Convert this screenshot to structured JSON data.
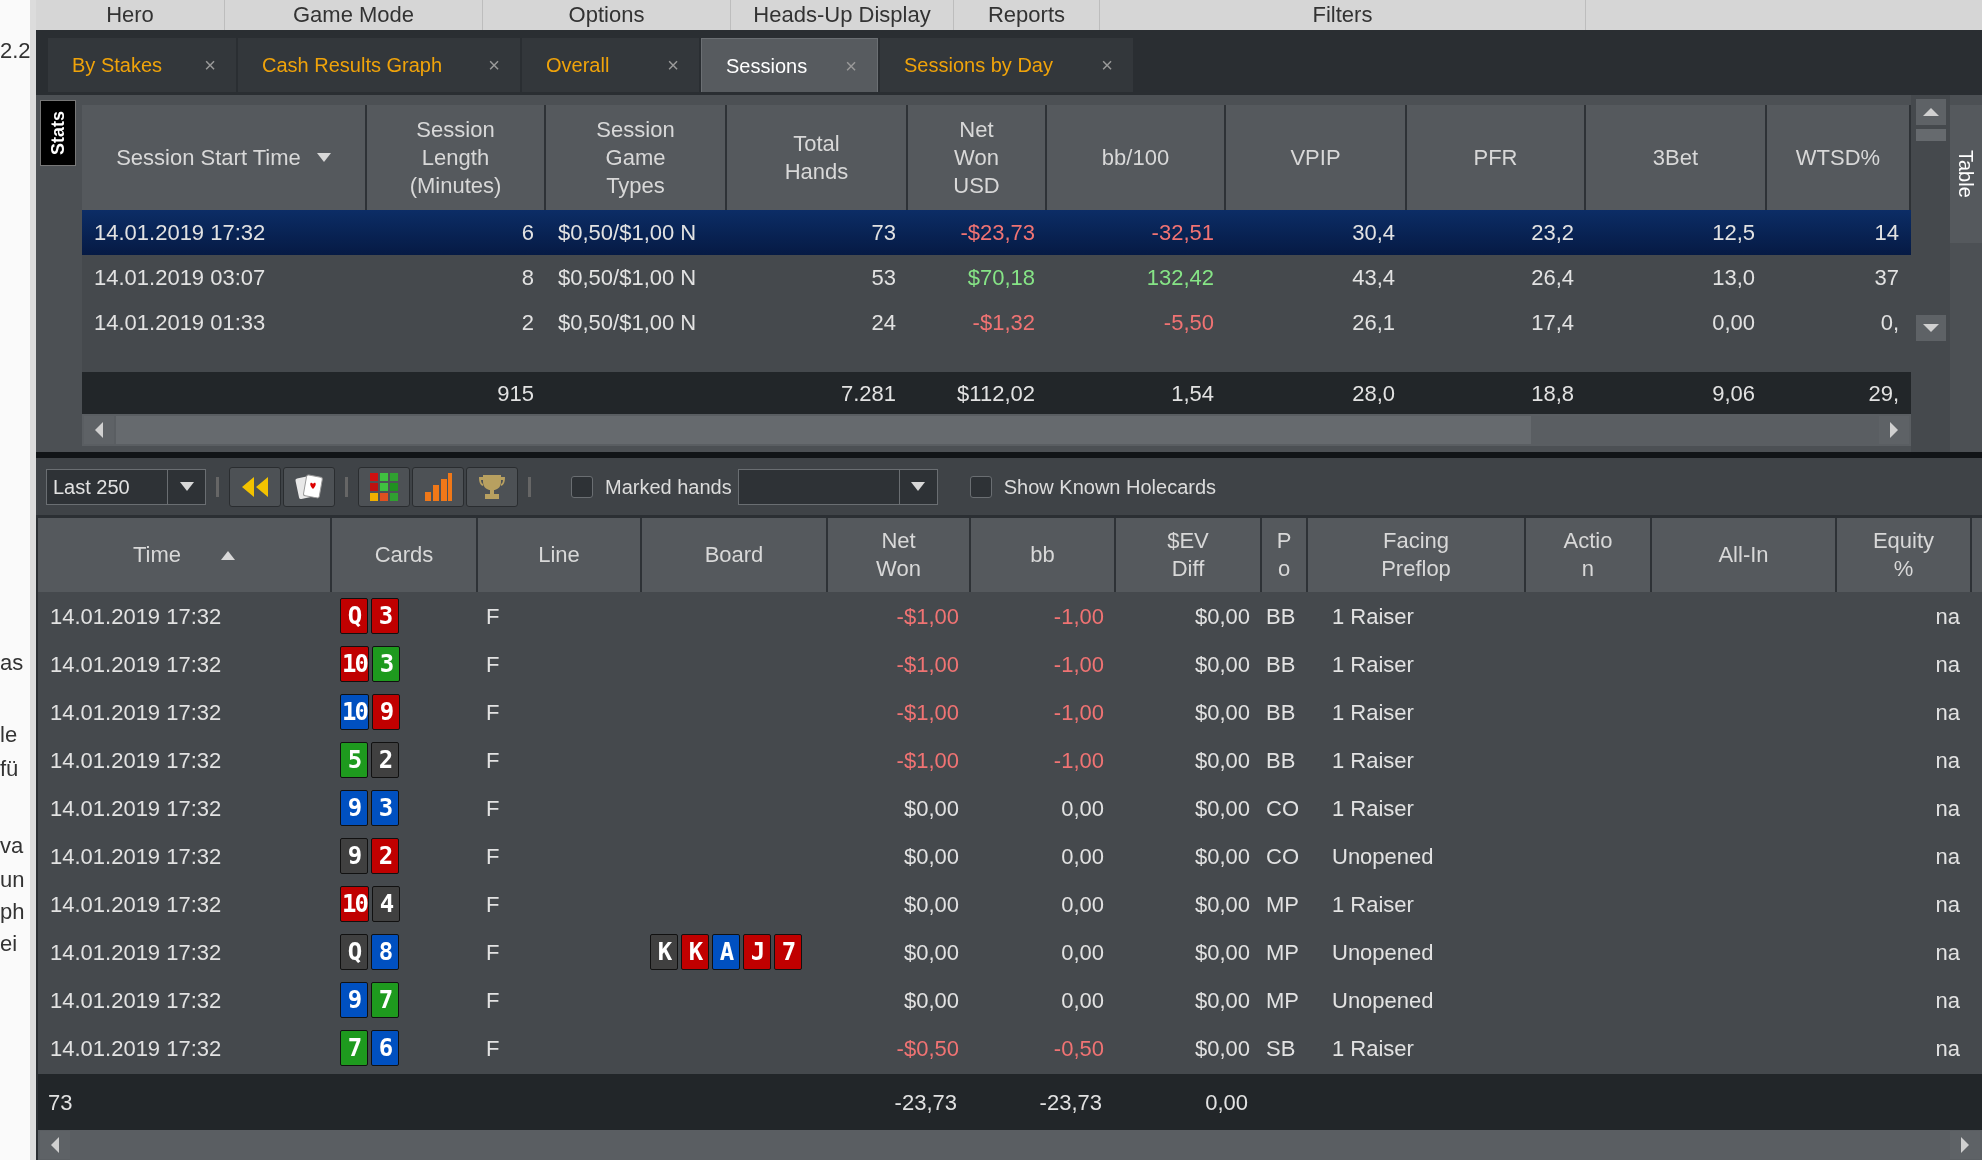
{
  "left_edge": [
    "2.2",
    "as",
    "le",
    "fü",
    "va",
    "un",
    "ph",
    "ei"
  ],
  "menu": [
    {
      "label": "Hero"
    },
    {
      "label": "Game Mode"
    },
    {
      "label": "Options"
    },
    {
      "label": "Heads-Up Display"
    },
    {
      "label": "Reports"
    },
    {
      "label": "Filters"
    }
  ],
  "tabs": [
    {
      "label": "By Stakes",
      "close": "×",
      "selected": false
    },
    {
      "label": "Cash Results Graph",
      "close": "×",
      "selected": false
    },
    {
      "label": "Overall",
      "close": "×",
      "selected": false
    },
    {
      "label": "Sessions",
      "close": "×",
      "selected": true
    },
    {
      "label": "Sessions by Day",
      "close": "×",
      "selected": false
    }
  ],
  "sessions": {
    "side_tab": "Stats",
    "right_tab": "Table",
    "columns": [
      {
        "lines": [
          "Session Start Time"
        ],
        "kind": "text",
        "sorted_descending": true
      },
      {
        "lines": [
          "Session",
          "Length",
          "(Minutes)"
        ],
        "kind": "number"
      },
      {
        "lines": [
          "Session",
          "Game",
          "Types"
        ],
        "kind": "text"
      },
      {
        "lines": [
          "Total",
          "Hands"
        ],
        "kind": "number"
      },
      {
        "lines": [
          "Net",
          "Won",
          "USD"
        ],
        "kind": "result"
      },
      {
        "lines": [
          "bb/100"
        ],
        "kind": "result"
      },
      {
        "lines": [
          "VPIP"
        ],
        "kind": "number"
      },
      {
        "lines": [
          "PFR"
        ],
        "kind": "number"
      },
      {
        "lines": [
          "3Bet"
        ],
        "kind": "number"
      },
      {
        "lines": [
          "WTSD%"
        ],
        "kind": "number"
      }
    ],
    "rows": [
      {
        "selected": true,
        "profit": false,
        "cells": [
          "14.01.2019 17:32",
          "6",
          "$0,50/$1,00 N",
          "73",
          "-$23,73",
          "-32,51",
          "30,4",
          "23,2",
          "12,5",
          "14"
        ]
      },
      {
        "selected": false,
        "profit": true,
        "cells": [
          "14.01.2019 03:07",
          "8",
          "$0,50/$1,00 N",
          "53",
          "$70,18",
          "132,42",
          "43,4",
          "26,4",
          "13,0",
          "37"
        ]
      },
      {
        "selected": false,
        "profit": false,
        "cells": [
          "14.01.2019 01:33",
          "2",
          "$0,50/$1,00 N",
          "24",
          "-$1,32",
          "-5,50",
          "26,1",
          "17,4",
          "0,00",
          "0,"
        ]
      }
    ],
    "totals": {
      "session_length": "915",
      "total_hands": "7.281",
      "net_won": "$112,02",
      "bb_100": "1,54",
      "vpip": "28,0",
      "pfr": "18,8",
      "three_bet": "9,06",
      "wtsd": "29,"
    }
  },
  "toolbar": {
    "range": "Last 250",
    "marked_hands": {
      "label": "Marked hands",
      "checked": false
    },
    "holecards": {
      "label": "Show Known Holecards",
      "checked": false
    }
  },
  "hands": {
    "columns": [
      {
        "lines": [
          "Time"
        ],
        "sorted_ascending": true
      },
      {
        "lines": [
          "Cards"
        ]
      },
      {
        "lines": [
          "Line"
        ]
      },
      {
        "lines": [
          "Board"
        ]
      },
      {
        "lines": [
          "Net",
          "Won"
        ]
      },
      {
        "lines": [
          "bb"
        ]
      },
      {
        "lines": [
          "$EV",
          "Diff"
        ]
      },
      {
        "lines": [
          "P",
          "o"
        ]
      },
      {
        "lines": [
          "Facing",
          "Preflop"
        ]
      },
      {
        "lines": [
          "Actio",
          "n"
        ]
      },
      {
        "lines": [
          "All-In"
        ]
      },
      {
        "lines": [
          "Equity",
          "%"
        ]
      }
    ],
    "rows": [
      {
        "time": "14.01.2019 17:32",
        "cards": [
          {
            "rank": "Q",
            "color": "#c00000"
          },
          {
            "rank": "3",
            "color": "#c00000"
          }
        ],
        "line": "F",
        "board": [],
        "net_won": "-$1,00",
        "bb": "-1,00",
        "loss": true,
        "ev_diff": "$0,00",
        "position": "BB",
        "facing": "1 Raiser",
        "equity": "na"
      },
      {
        "time": "14.01.2019 17:32",
        "cards": [
          {
            "rank": "10",
            "color": "#c00000"
          },
          {
            "rank": "3",
            "color": "#1e9a1e"
          }
        ],
        "line": "F",
        "board": [],
        "net_won": "-$1,00",
        "bb": "-1,00",
        "loss": true,
        "ev_diff": "$0,00",
        "position": "BB",
        "facing": "1 Raiser",
        "equity": "na"
      },
      {
        "time": "14.01.2019 17:32",
        "cards": [
          {
            "rank": "10",
            "color": "#0050c0"
          },
          {
            "rank": "9",
            "color": "#c00000"
          }
        ],
        "line": "F",
        "board": [],
        "net_won": "-$1,00",
        "bb": "-1,00",
        "loss": true,
        "ev_diff": "$0,00",
        "position": "BB",
        "facing": "1 Raiser",
        "equity": "na"
      },
      {
        "time": "14.01.2019 17:32",
        "cards": [
          {
            "rank": "5",
            "color": "#1e9a1e"
          },
          {
            "rank": "2",
            "color": "#404040"
          }
        ],
        "line": "F",
        "board": [],
        "net_won": "-$1,00",
        "bb": "-1,00",
        "loss": true,
        "ev_diff": "$0,00",
        "position": "BB",
        "facing": "1 Raiser",
        "equity": "na"
      },
      {
        "time": "14.01.2019 17:32",
        "cards": [
          {
            "rank": "9",
            "color": "#0050c0"
          },
          {
            "rank": "3",
            "color": "#0050c0"
          }
        ],
        "line": "F",
        "board": [],
        "net_won": "$0,00",
        "bb": "0,00",
        "loss": false,
        "ev_diff": "$0,00",
        "position": "CO",
        "facing": "1 Raiser",
        "equity": "na"
      },
      {
        "time": "14.01.2019 17:32",
        "cards": [
          {
            "rank": "9",
            "color": "#404040"
          },
          {
            "rank": "2",
            "color": "#c00000"
          }
        ],
        "line": "F",
        "board": [],
        "net_won": "$0,00",
        "bb": "0,00",
        "loss": false,
        "ev_diff": "$0,00",
        "position": "CO",
        "facing": "Unopened",
        "equity": "na"
      },
      {
        "time": "14.01.2019 17:32",
        "cards": [
          {
            "rank": "10",
            "color": "#c00000"
          },
          {
            "rank": "4",
            "color": "#404040"
          }
        ],
        "line": "F",
        "board": [],
        "net_won": "$0,00",
        "bb": "0,00",
        "loss": false,
        "ev_diff": "$0,00",
        "position": "MP",
        "facing": "1 Raiser",
        "equity": "na"
      },
      {
        "time": "14.01.2019 17:32",
        "cards": [
          {
            "rank": "Q",
            "color": "#404040"
          },
          {
            "rank": "8",
            "color": "#0050c0"
          }
        ],
        "line": "F",
        "board": [
          {
            "rank": "K",
            "color": "#404040"
          },
          {
            "rank": "K",
            "color": "#c00000"
          },
          {
            "rank": "A",
            "color": "#0050c0"
          },
          {
            "rank": "J",
            "color": "#c00000"
          },
          {
            "rank": "7",
            "color": "#c00000"
          }
        ],
        "net_won": "$0,00",
        "bb": "0,00",
        "loss": false,
        "ev_diff": "$0,00",
        "position": "MP",
        "facing": "Unopened",
        "equity": "na"
      },
      {
        "time": "14.01.2019 17:32",
        "cards": [
          {
            "rank": "9",
            "color": "#0050c0"
          },
          {
            "rank": "7",
            "color": "#1e9a1e"
          }
        ],
        "line": "F",
        "board": [],
        "net_won": "$0,00",
        "bb": "0,00",
        "loss": false,
        "ev_diff": "$0,00",
        "position": "MP",
        "facing": "Unopened",
        "equity": "na"
      },
      {
        "time": "14.01.2019 17:32",
        "cards": [
          {
            "rank": "7",
            "color": "#1e9a1e"
          },
          {
            "rank": "6",
            "color": "#0050c0"
          }
        ],
        "line": "F",
        "board": [],
        "net_won": "-$0,50",
        "bb": "-0,50",
        "loss": true,
        "ev_diff": "$0,00",
        "position": "SB",
        "facing": "1 Raiser",
        "equity": "na"
      }
    ],
    "totals": {
      "count": "73",
      "net_won": "-23,73",
      "bb": "-23,73",
      "ev_diff": "0,00"
    }
  }
}
